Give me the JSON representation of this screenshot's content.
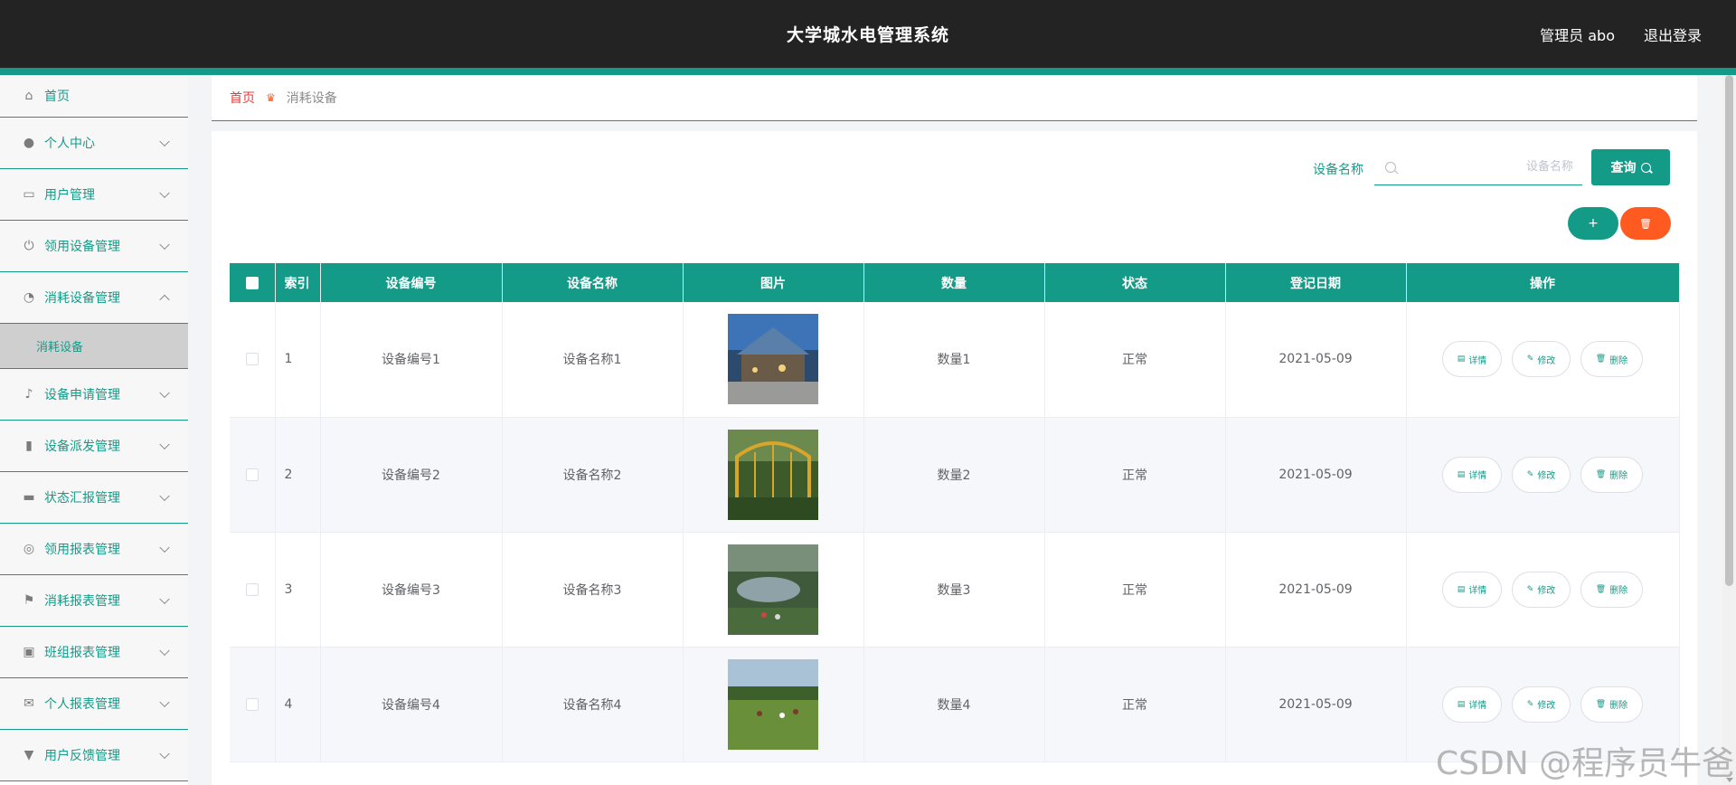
{
  "header": {
    "title": "大学城水电管理系统",
    "user": "管理员 abo",
    "logout": "退出登录"
  },
  "sidebar": {
    "items": [
      {
        "label": "首页",
        "icon": "home-icon"
      },
      {
        "label": "个人中心",
        "icon": "user-icon"
      },
      {
        "label": "用户管理",
        "icon": "chat-icon"
      },
      {
        "label": "领用设备管理",
        "icon": "power-icon"
      },
      {
        "label": "消耗设备管理",
        "icon": "gauge-icon",
        "expanded": true
      },
      {
        "label": "设备申请管理",
        "icon": "mic-icon"
      },
      {
        "label": "设备派发管理",
        "icon": "bar-chart-icon"
      },
      {
        "label": "状态汇报管理",
        "icon": "monitor-icon"
      },
      {
        "label": "领用报表管理",
        "icon": "target-icon"
      },
      {
        "label": "消耗报表管理",
        "icon": "flag-icon"
      },
      {
        "label": "班组报表管理",
        "icon": "clipboard-icon"
      },
      {
        "label": "个人报表管理",
        "icon": "mail-icon"
      },
      {
        "label": "用户反馈管理",
        "icon": "stamp-icon"
      }
    ],
    "submenu": {
      "label": "消耗设备"
    }
  },
  "breadcrumb": {
    "home": "首页",
    "current": "消耗设备"
  },
  "search": {
    "label": "设备名称",
    "placeholder": "设备名称",
    "button": "查询"
  },
  "actions": {
    "add": "+",
    "delete": "🗑"
  },
  "table": {
    "headers": [
      "索引",
      "设备编号",
      "设备名称",
      "图片",
      "数量",
      "状态",
      "登记日期",
      "操作"
    ],
    "rows": [
      {
        "index": "1",
        "code": "设备编号1",
        "name": "设备名称1",
        "qty": "数量1",
        "status": "正常",
        "date": "2021-05-09"
      },
      {
        "index": "2",
        "code": "设备编号2",
        "name": "设备名称2",
        "qty": "数量2",
        "status": "正常",
        "date": "2021-05-09"
      },
      {
        "index": "3",
        "code": "设备编号3",
        "name": "设备名称3",
        "qty": "数量3",
        "status": "正常",
        "date": "2021-05-09"
      },
      {
        "index": "4",
        "code": "设备编号4",
        "name": "设备名称4",
        "qty": "数量4",
        "status": "正常",
        "date": "2021-05-09"
      }
    ],
    "ops": {
      "detail": "详情",
      "edit": "修改",
      "delete": "删除"
    }
  },
  "watermark": "CSDN @程序员牛爸",
  "colors": {
    "primary": "#149b88",
    "danger": "#ff5a1f",
    "header_bg": "#232323"
  }
}
